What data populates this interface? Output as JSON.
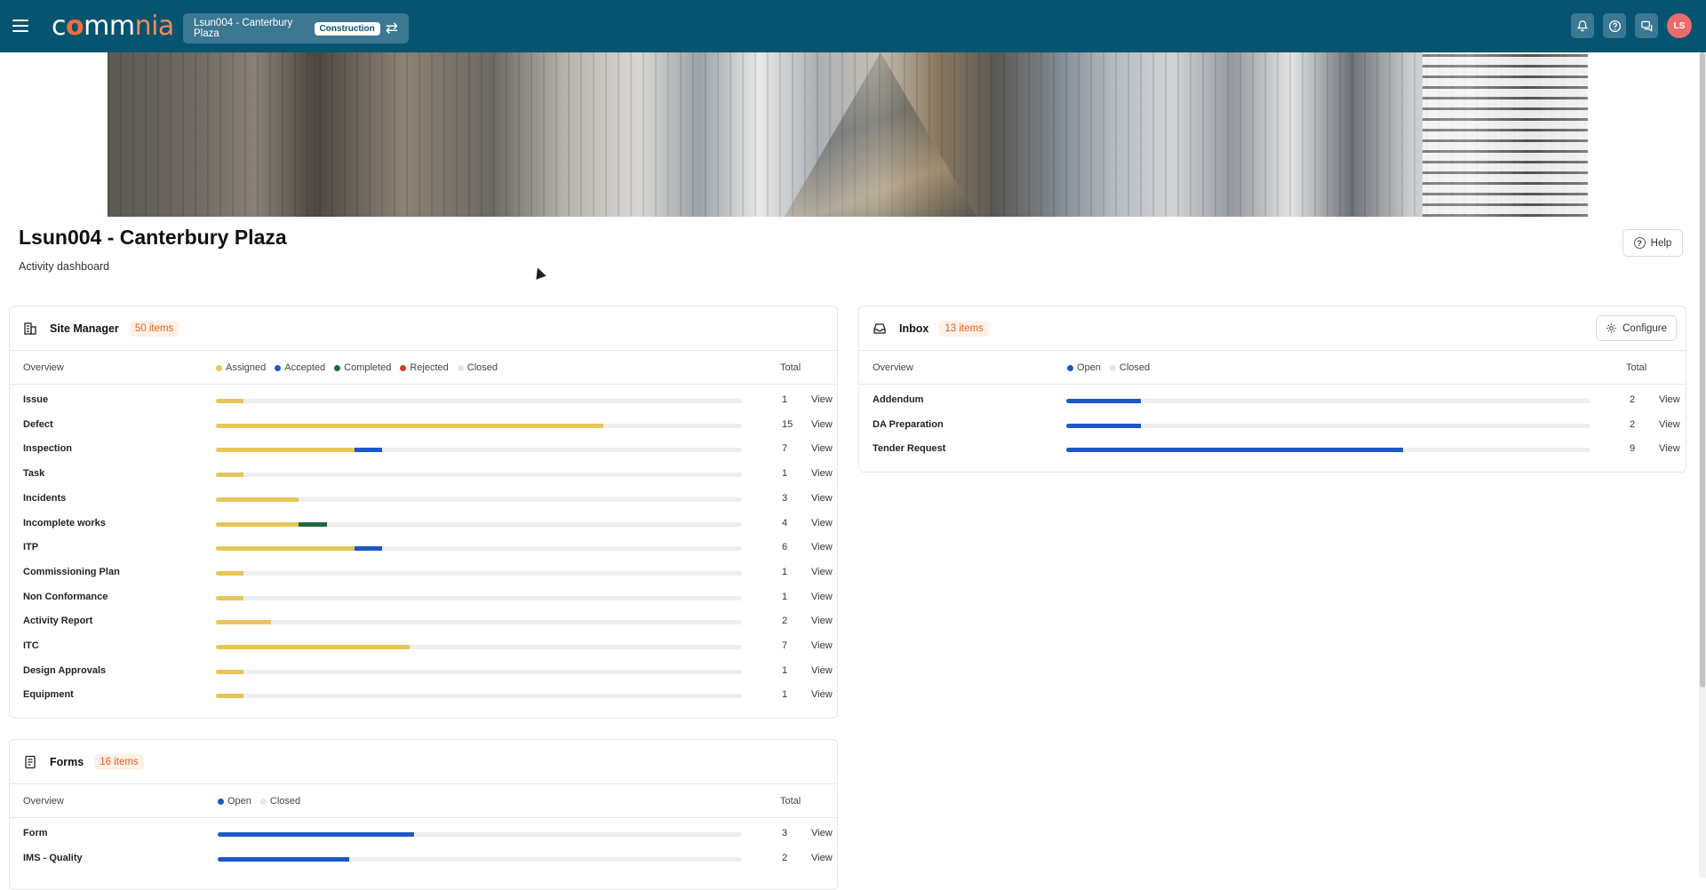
{
  "header": {
    "logo": {
      "c": "c",
      "o": "o",
      "mm": "mm",
      "n": "n",
      "ia": "ia"
    },
    "project_name": "Lsun004 - Canterbury Plaza",
    "project_tag": "Construction",
    "avatar_initials": "LS"
  },
  "page": {
    "title": "Lsun004 - Canterbury Plaza",
    "subtitle": "Activity dashboard",
    "help_label": "Help"
  },
  "site_manager": {
    "title": "Site Manager",
    "badge": "50 items",
    "overview_label": "Overview",
    "total_label": "Total",
    "legend": [
      {
        "label": "Assigned",
        "color": "#e8c55a"
      },
      {
        "label": "Accepted",
        "color": "#1c58c7"
      },
      {
        "label": "Completed",
        "color": "#1f6b3f"
      },
      {
        "label": "Rejected",
        "color": "#d6392b"
      },
      {
        "label": "Closed",
        "color": "#e4e6e9"
      }
    ],
    "rows": [
      {
        "label": "Issue",
        "total": "1",
        "view": "View",
        "segments": [
          {
            "color": "#e8c55a",
            "value": 1
          }
        ]
      },
      {
        "label": "Defect",
        "total": "15",
        "view": "View",
        "segments": [
          {
            "color": "#e8c55a",
            "value": 14
          }
        ]
      },
      {
        "label": "Inspection",
        "total": "7",
        "view": "View",
        "segments": [
          {
            "color": "#e8c55a",
            "value": 5
          },
          {
            "color": "#1c58c7",
            "value": 1
          }
        ]
      },
      {
        "label": "Task",
        "total": "1",
        "view": "View",
        "segments": [
          {
            "color": "#e8c55a",
            "value": 1
          }
        ]
      },
      {
        "label": "Incidents",
        "total": "3",
        "view": "View",
        "segments": [
          {
            "color": "#e8c55a",
            "value": 3
          }
        ]
      },
      {
        "label": "Incomplete works",
        "total": "4",
        "view": "View",
        "segments": [
          {
            "color": "#e8c55a",
            "value": 3
          },
          {
            "color": "#1f6b3f",
            "value": 1
          }
        ]
      },
      {
        "label": "ITP",
        "total": "6",
        "view": "View",
        "segments": [
          {
            "color": "#e8c55a",
            "value": 5
          },
          {
            "color": "#1c58c7",
            "value": 1
          }
        ]
      },
      {
        "label": "Commissioning Plan",
        "total": "1",
        "view": "View",
        "segments": [
          {
            "color": "#e8c55a",
            "value": 1
          }
        ]
      },
      {
        "label": "Non Conformance",
        "total": "1",
        "view": "View",
        "segments": [
          {
            "color": "#e8c55a",
            "value": 1
          }
        ]
      },
      {
        "label": "Activity Report",
        "total": "2",
        "view": "View",
        "segments": [
          {
            "color": "#e8c55a",
            "value": 2
          }
        ]
      },
      {
        "label": "ITC",
        "total": "7",
        "view": "View",
        "segments": [
          {
            "color": "#e8c55a",
            "value": 7
          }
        ]
      },
      {
        "label": "Design Approvals",
        "total": "1",
        "view": "View",
        "segments": [
          {
            "color": "#e8c55a",
            "value": 1
          }
        ]
      },
      {
        "label": "Equipment",
        "total": "1",
        "view": "View",
        "segments": [
          {
            "color": "#e8c55a",
            "value": 1
          }
        ]
      }
    ],
    "scale_max": 19
  },
  "inbox": {
    "title": "Inbox",
    "badge": "13 items",
    "configure_label": "Configure",
    "overview_label": "Overview",
    "total_label": "Total",
    "legend": [
      {
        "label": "Open",
        "color": "#1c58c7"
      },
      {
        "label": "Closed",
        "color": "#e4e6e9"
      }
    ],
    "rows": [
      {
        "label": "Addendum",
        "total": "2",
        "view": "View",
        "segments": [
          {
            "color": "#1c58c7",
            "value": 2
          }
        ]
      },
      {
        "label": "DA Preparation",
        "total": "2",
        "view": "View",
        "segments": [
          {
            "color": "#1c58c7",
            "value": 2
          }
        ]
      },
      {
        "label": "Tender Request",
        "total": "9",
        "view": "View",
        "segments": [
          {
            "color": "#1c58c7",
            "value": 9
          }
        ]
      }
    ],
    "scale_max": 14
  },
  "forms": {
    "title": "Forms",
    "badge": "16 items",
    "overview_label": "Overview",
    "total_label": "Total",
    "legend": [
      {
        "label": "Open",
        "color": "#1c58c7"
      },
      {
        "label": "Closed",
        "color": "#e4e6e9"
      }
    ],
    "rows": [
      {
        "label": "Form",
        "total": "3",
        "view": "View",
        "segments": [
          {
            "color": "#1c58c7",
            "value": 3
          }
        ]
      },
      {
        "label": "IMS - Quality",
        "total": "2",
        "view": "View",
        "segments": [
          {
            "color": "#1c58c7",
            "value": 2
          }
        ]
      }
    ],
    "scale_max": 8
  }
}
